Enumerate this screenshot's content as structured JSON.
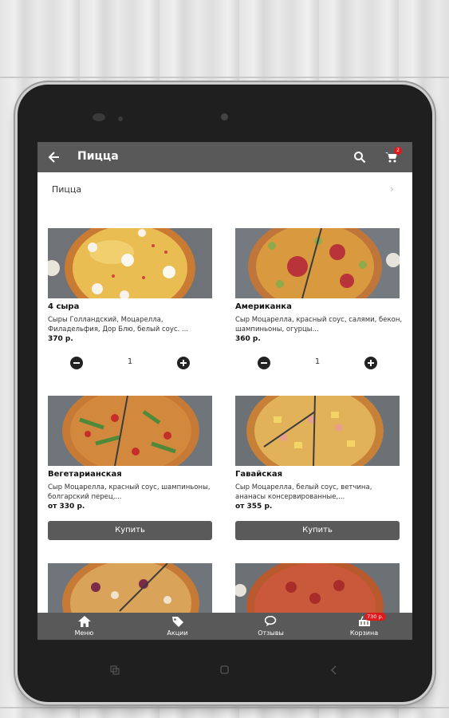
{
  "app": {
    "title": "Пицца"
  },
  "breadcrumb": {
    "label": "Пицца",
    "arrow": "›"
  },
  "header": {
    "cart_count": "2"
  },
  "products": [
    {
      "name": "4 сыра",
      "description": "Сыры Голландский, Моцарелла, Филадельфия, Дор Блю, белый соус. ...",
      "price": "370 р.",
      "quantity": "1",
      "mode": "stepper"
    },
    {
      "name": "Американка",
      "description": "Сыр Моцарелла, красный соус, салями, бекон, шампиньоны, огурцы...",
      "price": "360 р.",
      "quantity": "1",
      "mode": "stepper"
    },
    {
      "name": "Вегетарианская",
      "description": "Сыр Моцарелла, красный соус, шампиньоны, болгарский перец,...",
      "price": "от 330 р.",
      "buy_label": "Купить",
      "mode": "buy"
    },
    {
      "name": "Гавайская",
      "description": "Сыр Моцарелла, белый соус, ветчина, ананасы консервированные,...",
      "price": "от 355 р.",
      "buy_label": "Купить",
      "mode": "buy"
    }
  ],
  "bottom_nav": [
    {
      "label": "Меню",
      "icon": "home-icon"
    },
    {
      "label": "Акции",
      "icon": "tag-icon"
    },
    {
      "label": "Отзывы",
      "icon": "chat-icon"
    },
    {
      "label": "Корзина",
      "icon": "basket-icon",
      "badge": "730 р."
    }
  ],
  "colors": {
    "bar": "#595959",
    "badge": "#e0191c",
    "button": "#5a5a5a"
  }
}
